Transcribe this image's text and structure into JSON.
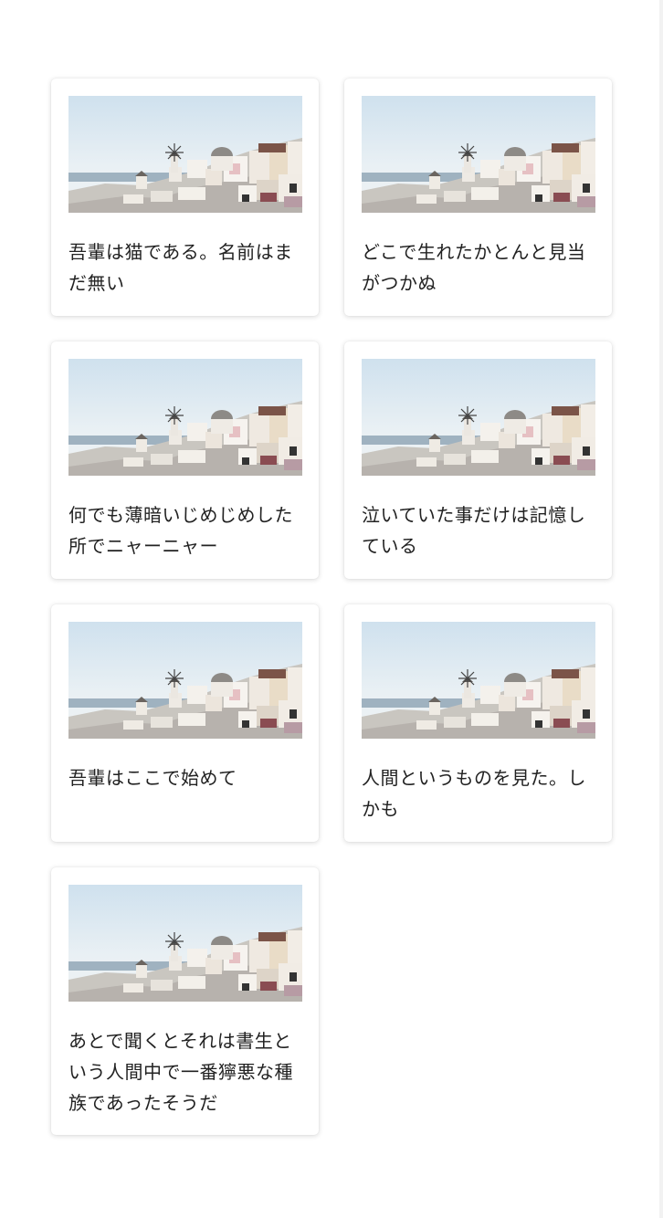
{
  "cards": [
    {
      "caption": "吾輩は猫である。名前はまだ無い"
    },
    {
      "caption": "どこで生れたかとんと見当がつかぬ"
    },
    {
      "caption": "何でも薄暗いじめじめした所でニャーニャー"
    },
    {
      "caption": "泣いていた事だけは記憶している"
    },
    {
      "caption": "吾輩はここで始めて"
    },
    {
      "caption": "人間というものを見た。しかも"
    },
    {
      "caption": "あとで聞くとそれは書生という人間中で一番獰悪な種族であったそうだ"
    }
  ],
  "image": {
    "icon": "santorini-photo"
  }
}
